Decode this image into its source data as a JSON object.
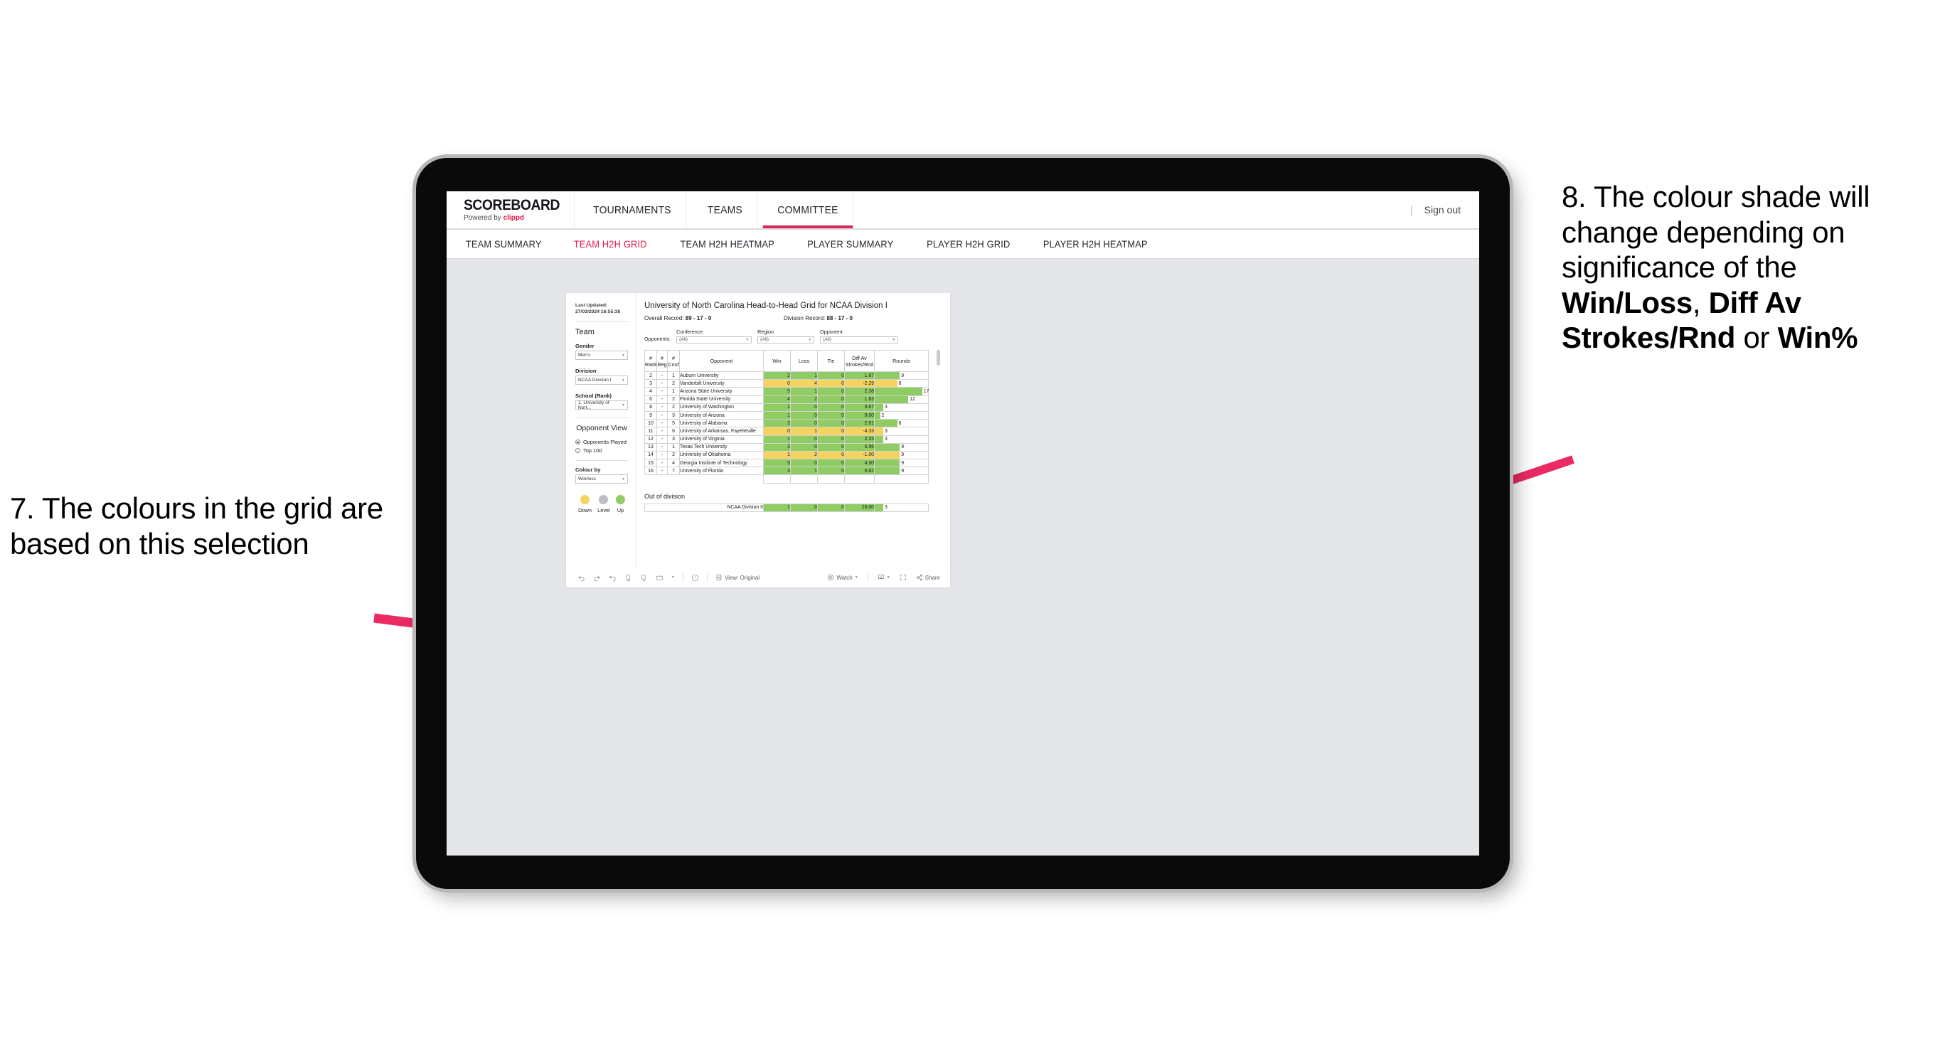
{
  "annotations": {
    "left": {
      "number": "7.",
      "text": "7. The colours in the grid are based on this selection"
    },
    "right": {
      "lead": "8. The colour shade will change depending on significance of the ",
      "bold1": "Win/Loss",
      "mid1": ", ",
      "bold2": "Diff Av Strokes/Rnd",
      "mid2": " or ",
      "bold3": "Win%"
    },
    "arrow_color": "#ea2a63"
  },
  "app": {
    "brand": {
      "name": "SCOREBOARD",
      "powered_prefix": "Powered by ",
      "powered_brand": "clippd"
    },
    "nav": [
      {
        "label": "TOURNAMENTS",
        "active": false
      },
      {
        "label": "TEAMS",
        "active": false
      },
      {
        "label": "COMMITTEE",
        "active": true
      }
    ],
    "signout": {
      "divider": "|",
      "label": "Sign out"
    },
    "subnav": [
      {
        "label": "TEAM SUMMARY",
        "active": false
      },
      {
        "label": "TEAM H2H GRID",
        "active": true
      },
      {
        "label": "TEAM H2H HEATMAP",
        "active": false
      },
      {
        "label": "PLAYER SUMMARY",
        "active": false
      },
      {
        "label": "PLAYER H2H GRID",
        "active": false
      },
      {
        "label": "PLAYER H2H HEATMAP",
        "active": false
      }
    ],
    "accent": "#e8174a",
    "accent_underline": "#d42a5b"
  },
  "sidebar": {
    "last_updated": "Last Updated: 27/03/2024 16:55:38",
    "team_heading": "Team",
    "gender": {
      "label": "Gender",
      "value": "Men's"
    },
    "division": {
      "label": "Division",
      "value": "NCAA Division I"
    },
    "school": {
      "label": "School (Rank)",
      "value": "1. University of Nort..."
    },
    "opponent_view": {
      "heading": "Opponent View",
      "options": [
        {
          "label": "Opponents Played",
          "selected": true
        },
        {
          "label": "Top 100",
          "selected": false
        }
      ]
    },
    "colour_by": {
      "label": "Colour by",
      "value": "Win/loss"
    },
    "legend": [
      {
        "label": "Down",
        "color": "#f4d35e"
      },
      {
        "label": "Level",
        "color": "#bdbdc4"
      },
      {
        "label": "Up",
        "color": "#8fcc63"
      }
    ]
  },
  "main": {
    "title": "University of North Carolina Head-to-Head Grid for NCAA Division I",
    "overall_record_label": "Overall Record: ",
    "overall_record_value": "89 - 17 - 0",
    "division_record_label": "Division Record: ",
    "division_record_value": "88 - 17 - 0",
    "opponents_label": "Opponents:",
    "filters": [
      {
        "label": "Conference",
        "value": "(All)"
      },
      {
        "label": "Region",
        "value": "(All)"
      },
      {
        "label": "Opponent",
        "value": "(All)"
      }
    ],
    "columns": [
      {
        "l1": "#",
        "l2": "Rank"
      },
      {
        "l1": "#",
        "l2": "Reg"
      },
      {
        "l1": "#",
        "l2": "Conf"
      },
      {
        "l1": "Opponent",
        "l2": ""
      },
      {
        "l1": "Win",
        "l2": ""
      },
      {
        "l1": "Loss",
        "l2": ""
      },
      {
        "l1": "Tie",
        "l2": ""
      },
      {
        "l1": "Diff Av",
        "l2": "Strokes/Rnd"
      },
      {
        "l1": "Rounds",
        "l2": ""
      }
    ],
    "rows": [
      {
        "rank": "2",
        "reg": "-",
        "conf": "1",
        "opponent": "Auburn University",
        "win": "2",
        "loss": "1",
        "tie": "0",
        "diff": "1.67",
        "rounds": "9",
        "bar": 47,
        "shade": "g"
      },
      {
        "rank": "3",
        "reg": "-",
        "conf": "2",
        "opponent": "Vanderbilt University",
        "win": "0",
        "loss": "4",
        "tie": "0",
        "diff": "-2.29",
        "rounds": "8",
        "bar": 42,
        "shade": "y"
      },
      {
        "rank": "4",
        "reg": "-",
        "conf": "1",
        "opponent": "Arizona State University",
        "win": "5",
        "loss": "1",
        "tie": "0",
        "diff": "2.28",
        "rounds": "17",
        "bar": 89,
        "shade": "g"
      },
      {
        "rank": "6",
        "reg": "-",
        "conf": "2",
        "opponent": "Florida State University",
        "win": "4",
        "loss": "2",
        "tie": "0",
        "diff": "1.83",
        "rounds": "12",
        "bar": 63,
        "shade": "g"
      },
      {
        "rank": "8",
        "reg": "-",
        "conf": "2",
        "opponent": "University of Washington",
        "win": "1",
        "loss": "0",
        "tie": "0",
        "diff": "3.67",
        "rounds": "3",
        "bar": 16,
        "shade": "g"
      },
      {
        "rank": "9",
        "reg": "-",
        "conf": "3",
        "opponent": "University of Arizona",
        "win": "1",
        "loss": "0",
        "tie": "0",
        "diff": "9.00",
        "rounds": "2",
        "bar": 10,
        "shade": "g"
      },
      {
        "rank": "10",
        "reg": "-",
        "conf": "5",
        "opponent": "University of Alabama",
        "win": "3",
        "loss": "0",
        "tie": "0",
        "diff": "2.61",
        "rounds": "8",
        "bar": 42,
        "shade": "g"
      },
      {
        "rank": "11",
        "reg": "-",
        "conf": "6",
        "opponent": "University of Arkansas, Fayetteville",
        "win": "0",
        "loss": "1",
        "tie": "0",
        "diff": "-4.33",
        "rounds": "3",
        "bar": 16,
        "shade": "y"
      },
      {
        "rank": "12",
        "reg": "-",
        "conf": "3",
        "opponent": "University of Virginia",
        "win": "1",
        "loss": "0",
        "tie": "0",
        "diff": "2.33",
        "rounds": "3",
        "bar": 16,
        "shade": "g"
      },
      {
        "rank": "13",
        "reg": "-",
        "conf": "1",
        "opponent": "Texas Tech University",
        "win": "3",
        "loss": "0",
        "tie": "0",
        "diff": "5.56",
        "rounds": "9",
        "bar": 47,
        "shade": "g"
      },
      {
        "rank": "14",
        "reg": "-",
        "conf": "2",
        "opponent": "University of Oklahoma",
        "win": "1",
        "loss": "2",
        "tie": "0",
        "diff": "-1.00",
        "rounds": "9",
        "bar": 47,
        "shade": "y"
      },
      {
        "rank": "15",
        "reg": "-",
        "conf": "4",
        "opponent": "Georgia Institute of Technology",
        "win": "5",
        "loss": "0",
        "tie": "0",
        "diff": "4.50",
        "rounds": "9",
        "bar": 47,
        "shade": "g"
      },
      {
        "rank": "16",
        "reg": "-",
        "conf": "7",
        "opponent": "University of Florida",
        "win": "3",
        "loss": "1",
        "tie": "0",
        "diff": "6.62",
        "rounds": "9",
        "bar": 47,
        "shade": "g"
      }
    ],
    "out_of_division": {
      "title": "Out of division",
      "row": {
        "name": "NCAA Division II",
        "win": "1",
        "loss": "0",
        "tie": "0",
        "diff": "26.00",
        "rounds": "3",
        "bar": 16,
        "shade": "g"
      }
    }
  },
  "toolbar": {
    "left_icons": [
      "undo-icon",
      "redo-icon",
      "revert-icon",
      "refresh-data-icon",
      "pause-updates-icon",
      "alert-icon",
      "dropdown-caret"
    ],
    "view_label": "View: Original",
    "watch_label": "Watch",
    "share_label": "Share"
  },
  "chart_data": {
    "type": "table",
    "title": "University of North Carolina Head-to-Head Grid for NCAA Division I",
    "colour_by": "Win/loss",
    "colour_scale": {
      "down": "#f4d35e",
      "level": "#bdbdc4",
      "up": "#8fcc63"
    },
    "columns": [
      "# Rank",
      "# Reg",
      "# Conf",
      "Opponent",
      "Win",
      "Loss",
      "Tie",
      "Diff Av Strokes/Rnd",
      "Rounds"
    ],
    "values": [
      [
        "2",
        "-",
        "1",
        "Auburn University",
        2,
        1,
        0,
        1.67,
        9
      ],
      [
        "3",
        "-",
        "2",
        "Vanderbilt University",
        0,
        4,
        0,
        -2.29,
        8
      ],
      [
        "4",
        "-",
        "1",
        "Arizona State University",
        5,
        1,
        0,
        2.28,
        17
      ],
      [
        "6",
        "-",
        "2",
        "Florida State University",
        4,
        2,
        0,
        1.83,
        12
      ],
      [
        "8",
        "-",
        "2",
        "University of Washington",
        1,
        0,
        0,
        3.67,
        3
      ],
      [
        "9",
        "-",
        "3",
        "University of Arizona",
        1,
        0,
        0,
        9.0,
        2
      ],
      [
        "10",
        "-",
        "5",
        "University of Alabama",
        3,
        0,
        0,
        2.61,
        8
      ],
      [
        "11",
        "-",
        "6",
        "University of Arkansas, Fayetteville",
        0,
        1,
        0,
        -4.33,
        3
      ],
      [
        "12",
        "-",
        "3",
        "University of Virginia",
        1,
        0,
        0,
        2.33,
        3
      ],
      [
        "13",
        "-",
        "1",
        "Texas Tech University",
        3,
        0,
        0,
        5.56,
        9
      ],
      [
        "14",
        "-",
        "2",
        "University of Oklahoma",
        1,
        2,
        0,
        -1.0,
        9
      ],
      [
        "15",
        "-",
        "4",
        "Georgia Institute of Technology",
        5,
        0,
        0,
        4.5,
        9
      ],
      [
        "16",
        "-",
        "7",
        "University of Florida",
        3,
        1,
        0,
        6.62,
        9
      ]
    ],
    "out_of_division": [
      [
        "NCAA Division II",
        1,
        0,
        0,
        26.0,
        3
      ]
    ],
    "overall_record": "89 - 17 - 0",
    "division_record": "88 - 17 - 0",
    "rounds_axis_max": 19
  }
}
